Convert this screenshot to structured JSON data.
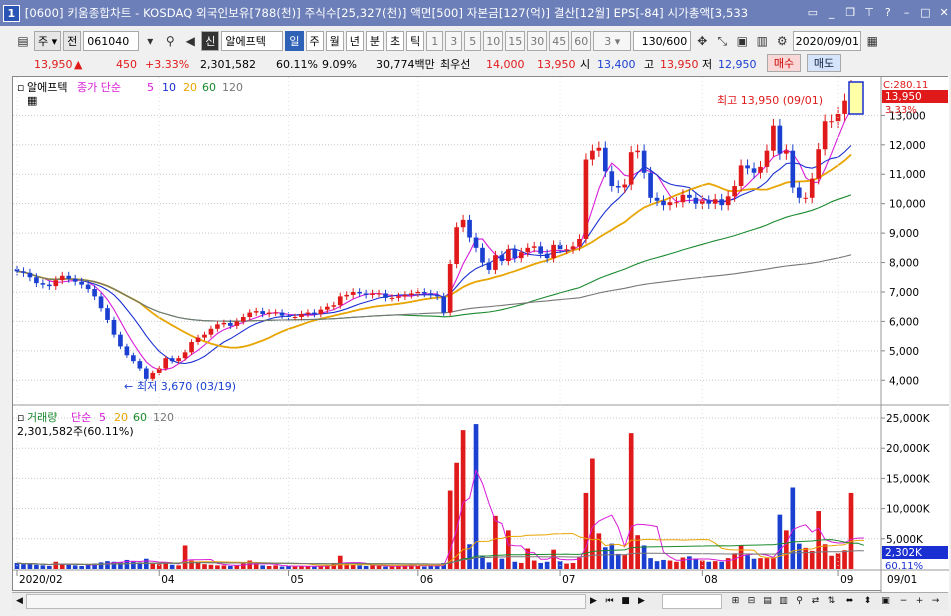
{
  "window": {
    "number": "1",
    "title": "[0600] 키움종합차트 - KOSDAQ 외국인보유[788(천)] 주식수[25,327(천)] 액면[500] 자본금[127(억)] 결산[12월] EPS[-84] 시가총액[3,533"
  },
  "toolbar": {
    "period_unit": "주",
    "prev_label": "전",
    "code": "061040",
    "name_tag": "신",
    "stock_name": "알에프텍",
    "periods": [
      "일",
      "주",
      "월",
      "년",
      "분",
      "초",
      "틱"
    ],
    "minutes": [
      "1",
      "3",
      "5",
      "10",
      "15",
      "30",
      "45",
      "60"
    ],
    "interval_value": "3",
    "count": "130/600",
    "date": "2020/09/01"
  },
  "quote": {
    "price": "13,950",
    "change": "450",
    "change_pct": "+3.33%",
    "volume": "2,301,582",
    "volume_ratio": "60.11%",
    "turnover": "9.09%",
    "amount": "30,774백만",
    "bid_label": "최우선",
    "ask_price": "14,000",
    "bid_price": "13,950",
    "open_label": "시",
    "open": "13,400",
    "high_label": "고",
    "high": "13,950",
    "low_label": "저",
    "low": "12,950",
    "buy_label": "매수",
    "sell_label": "매도"
  },
  "price_panel": {
    "name": "알에프텍",
    "legend_prefix": "종가 단순",
    "ma_periods": [
      "5",
      "10",
      "20",
      "60",
      "120"
    ],
    "ma_colors": [
      "#d81bd8",
      "#1a2fd1",
      "#e8a400",
      "#1a8a2e",
      "#777777"
    ],
    "ymin": 3500,
    "ymax": 14100,
    "y_ticks": [
      "13,000",
      "12,000",
      "11,000",
      "10,000",
      "9,000",
      "8,000",
      "7,000",
      "6,000",
      "5,000",
      "4,000"
    ],
    "axis_top_label": "C:280.11",
    "current_price_label": "13,950",
    "current_pct_label": "3.33%",
    "high_annotation": "최고 13,950 (09/01)",
    "low_annotation": "최저 3,670 (03/19)"
  },
  "volume_panel": {
    "title": "거래량",
    "legend_prefix": "단순",
    "ma_periods": [
      "5",
      "20",
      "60",
      "120"
    ],
    "value_label": "2,301,582주(60.11%)",
    "y_ticks": [
      "25,000K",
      "20,000K",
      "15,000K",
      "10,000K",
      "5,000K"
    ],
    "current_label": "2,302K",
    "current_pct": "60.11%"
  },
  "x_axis": {
    "labels": [
      "2020/02",
      "04",
      "05",
      "06",
      "07",
      "08",
      "09"
    ],
    "current_date": "09/01"
  },
  "chart_data": {
    "type": "candlestick",
    "x_range": [
      "2020/02",
      "2020/09/01"
    ],
    "price_extremes": {
      "high": 13950,
      "high_date": "09/01",
      "low": 3670,
      "low_date": "03/19"
    },
    "closes": [
      7700,
      7650,
      7500,
      7300,
      7250,
      7200,
      7400,
      7550,
      7450,
      7350,
      7250,
      7100,
      6850,
      6450,
      6050,
      5550,
      5150,
      4850,
      4650,
      4400,
      4050,
      4250,
      4400,
      4750,
      4650,
      4750,
      4950,
      5300,
      5450,
      5550,
      5750,
      5900,
      5950,
      5850,
      6000,
      6150,
      6300,
      6350,
      6250,
      6300,
      6300,
      6200,
      6150,
      6150,
      6250,
      6300,
      6250,
      6400,
      6500,
      6550,
      6850,
      6900,
      7000,
      6950,
      6900,
      6950,
      6950,
      6800,
      6800,
      6850,
      6900,
      6950,
      7000,
      6950,
      6900,
      6850,
      6300,
      7950,
      9200,
      9450,
      8850,
      8500,
      8000,
      7750,
      8250,
      8050,
      8450,
      8150,
      8350,
      8500,
      8550,
      8300,
      8150,
      8600,
      8450,
      8450,
      8550,
      8800,
      11500,
      11800,
      11900,
      11100,
      10600,
      10550,
      10650,
      11750,
      11800,
      11050,
      10200,
      10100,
      9950,
      10050,
      10050,
      10300,
      10200,
      10000,
      10100,
      10000,
      10150,
      9950,
      10250,
      10600,
      11300,
      11200,
      11050,
      11250,
      11800,
      12650,
      11700,
      11800,
      10550,
      10200,
      10200,
      10850,
      11850,
      12800,
      12800,
      13050,
      13500,
      13950
    ],
    "volumes_k": [
      1000,
      800,
      900,
      700,
      600,
      500,
      1200,
      900,
      700,
      600,
      500,
      700,
      900,
      1100,
      1300,
      1200,
      1100,
      1500,
      1300,
      1100,
      1700,
      900,
      800,
      1100,
      700,
      600,
      3900,
      1400,
      1100,
      800,
      700,
      600,
      600,
      500,
      600,
      900,
      1400,
      800,
      600,
      500,
      600,
      400,
      500,
      400,
      500,
      500,
      400,
      500,
      600,
      1000,
      2200,
      800,
      700,
      600,
      500,
      600,
      500,
      400,
      400,
      500,
      600,
      700,
      500,
      400,
      500,
      500,
      1000,
      13000,
      17600,
      23000,
      4100,
      24000,
      2100,
      1100,
      8800,
      1700,
      6400,
      1200,
      1000,
      3400,
      1400,
      1000,
      1200,
      3200,
      1300,
      900,
      1000,
      1900,
      12600,
      18300,
      5900,
      3600,
      4200,
      2500,
      2300,
      22500,
      5600,
      3900,
      1800,
      1300,
      1500,
      1400,
      1200,
      1900,
      2100,
      1700,
      1400,
      1200,
      1300,
      1200,
      1800,
      2600,
      3900,
      2300,
      1700,
      1800,
      1800,
      1900,
      9000,
      6400,
      13500,
      4200,
      3500,
      3000,
      9600,
      4100,
      2200,
      2600,
      3100,
      12600,
      5100,
      2300
    ]
  }
}
